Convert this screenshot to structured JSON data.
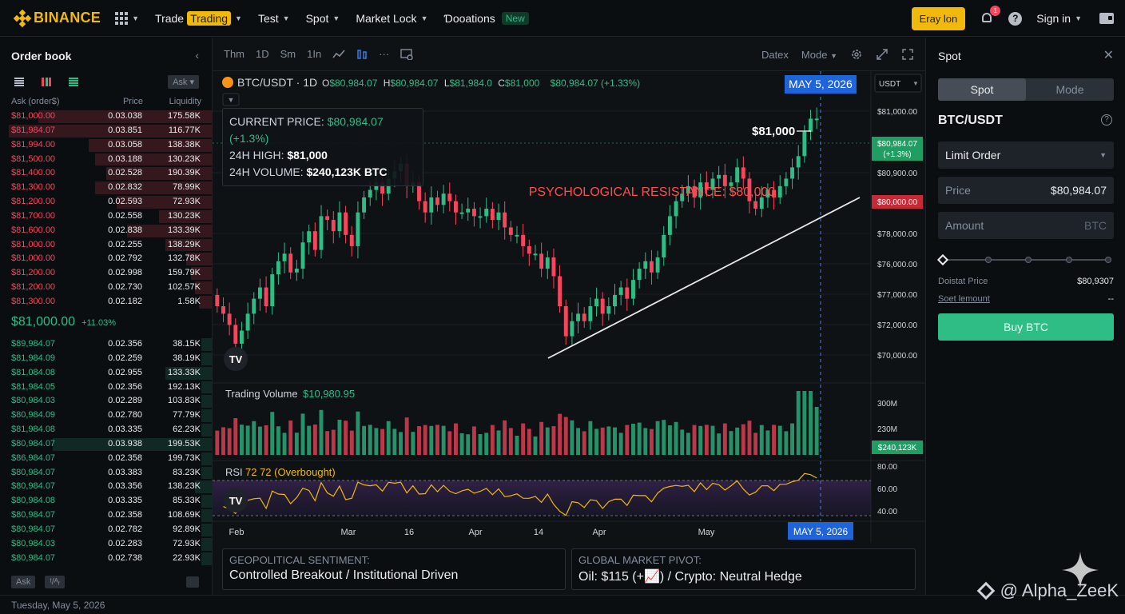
{
  "brand": {
    "name": "BINANCE"
  },
  "nav": {
    "items": [
      {
        "label": "Trade",
        "pill": "Trading"
      },
      {
        "label": "Test"
      },
      {
        "label": "Spot"
      },
      {
        "label": "Market Lock"
      },
      {
        "label": "Ɗooations",
        "badge": "New"
      }
    ],
    "cta": "Eray lon",
    "notif_count": "1",
    "help_glyph": "?",
    "signin": "Sign in"
  },
  "orderbook": {
    "title": "Order book",
    "ask_select": "Ask",
    "headers": {
      "c1": "Ask (order$)",
      "c2": "Price",
      "c3": "Liquidity"
    },
    "asks": [
      {
        "p": "$81,000.00",
        "q": "0.03.038",
        "l": "175.58K",
        "d": 0.82
      },
      {
        "p": "$81,984.07",
        "q": "0.03.851",
        "l": "116.77K",
        "d": 0.96
      },
      {
        "p": "$81,994.00",
        "q": "0.03.058",
        "l": "138.38K",
        "d": 0.58
      },
      {
        "p": "$81,500.00",
        "q": "0.03.188",
        "l": "130.23K",
        "d": 0.55
      },
      {
        "p": "$81,400.00",
        "q": "0.02.528",
        "l": "190.39K",
        "d": 0.5
      },
      {
        "p": "$81,300.00",
        "q": "0.02.832",
        "l": "78.99K",
        "d": 0.55
      },
      {
        "p": "$81,200.00",
        "q": "0.02.593",
        "l": "72.93K",
        "d": 0.45
      },
      {
        "p": "$81,700.00",
        "q": "0.02.558",
        "l": "130.23K",
        "d": 0.25
      },
      {
        "p": "$81,600.00",
        "q": "0.02.838",
        "l": "133.39K",
        "d": 0.4
      },
      {
        "p": "$81,000.00",
        "q": "0.02.255",
        "l": "138.29K",
        "d": 0.22
      },
      {
        "p": "$81,000.00",
        "q": "0.02.792",
        "l": "132.78K",
        "d": 0.12
      },
      {
        "p": "$81,200.00",
        "q": "0.02.998",
        "l": "159.79K",
        "d": 0.1
      },
      {
        "p": "$81,200.00",
        "q": "0.02.730",
        "l": "102.57K",
        "d": 0.08
      },
      {
        "p": "$81,300.00",
        "q": "0.02.182",
        "l": "1.58K",
        "d": 0.06
      }
    ],
    "mid_price": "$81,000.00",
    "mid_change": "+11.03%",
    "bids": [
      {
        "p": "$89,984.07",
        "q": "0.02.356",
        "l": "38.15K",
        "d": 0.05
      },
      {
        "p": "$81,984.09",
        "q": "0.02.259",
        "l": "38.19K",
        "d": 0.05
      },
      {
        "p": "$81,084.08",
        "q": "0.02.955",
        "l": "133.33K",
        "d": 0.22
      },
      {
        "p": "$81,984.05",
        "q": "0.02.356",
        "l": "192.13K",
        "d": 0.05
      },
      {
        "p": "$80,984.03",
        "q": "0.02.289",
        "l": "103.83K",
        "d": 0.05
      },
      {
        "p": "$80,984.09",
        "q": "0.02.780",
        "l": "77.79K",
        "d": 0.05
      },
      {
        "p": "$81,984.08",
        "q": "0.03.335",
        "l": "62.23K",
        "d": 0.05
      },
      {
        "p": "$80,984.07",
        "q": "0.03.938",
        "l": "199.53K",
        "d": 0.75
      },
      {
        "p": "$86,984.07",
        "q": "0.02.358",
        "l": "199.73K",
        "d": 0.05
      },
      {
        "p": "$80,984.07",
        "q": "0.03.383",
        "l": "83.23K",
        "d": 0.05
      },
      {
        "p": "$80,984.07",
        "q": "0.03.356",
        "l": "138.23K",
        "d": 0.08
      },
      {
        "p": "$80,984.08",
        "q": "0.03.335",
        "l": "85.33K",
        "d": 0.05
      },
      {
        "p": "$80,984.07",
        "q": "0.02.358",
        "l": "108.69K",
        "d": 0.05
      },
      {
        "p": "$80,984.07",
        "q": "0.02.782",
        "l": "92.89K",
        "d": 0.05
      },
      {
        "p": "$80,984.03",
        "q": "0.02.283",
        "l": "72.93K",
        "d": 0.05
      },
      {
        "p": "$80,984.07",
        "q": "0.02.738",
        "l": "22.93K",
        "d": 0.05
      }
    ],
    "footer_left": "Ask",
    "footer_chip": "ᵗ/ᴬᵣ"
  },
  "chart_toolbar": {
    "intervals": [
      "Thm",
      "1D",
      "Sm",
      "1In"
    ],
    "right": [
      "Datex",
      "Mode"
    ]
  },
  "chart_data": {
    "type": "candlestick",
    "symbol": "BTC/USDT · 1D",
    "ohlc_text": {
      "o": "$80,984.07",
      "h": "$80,984.07",
      "l": "$81,984.0",
      "c": "$81,000",
      "chg": "$80,984.07 (+1.33%)"
    },
    "date_flag": "MAY 5, 2026",
    "currency_select": "USDT",
    "price_axis_labels": [
      "$81,000.00",
      "$80,900.00",
      "$78,000.00",
      "$76,000.00",
      "$77,000.00",
      "$72,000.00",
      "$70,000.00"
    ],
    "current_price_tag": [
      "$80,984.07",
      "(+1.3%)"
    ],
    "resistance": {
      "label": "PSYCHOLOGICAL RESISTANCE: $80,000",
      "tag": "$80,000.00"
    },
    "peak_label": "$81,000",
    "x_labels": [
      "Feb",
      "Mar",
      "16",
      "Apr",
      "14",
      "Apr",
      "May",
      "MAY 5, 2026"
    ],
    "candle_closes": [
      72.6,
      72.2,
      71.6,
      70.6,
      71.3,
      72.2,
      73.0,
      73.6,
      72.6,
      74.3,
      75.0,
      75.4,
      74.4,
      74.6,
      76.0,
      76.6,
      75.6,
      77.4,
      77.2,
      76.6,
      77.6,
      76.4,
      75.8,
      77.6,
      78.4,
      78.8,
      79.2,
      78.6,
      79.4,
      79.8,
      80.2,
      79.0,
      79.2,
      78.2,
      77.6,
      78.4,
      78.0,
      78.6,
      78.2,
      77.6,
      77.6,
      77.8,
      77.4,
      77.4,
      77.8,
      77.2,
      77.6,
      76.8,
      76.4,
      76.4,
      75.8,
      75.4,
      75.4,
      74.6,
      75.2,
      74.2,
      72.6,
      71.0,
      71.8,
      72.2,
      71.8,
      72.6,
      73.0,
      72.2,
      72.6,
      73.2,
      73.6,
      73.0,
      74.0,
      74.6,
      75.0,
      74.4,
      75.2,
      76.4,
      77.4,
      78.2,
      78.6,
      79.0,
      78.4,
      79.2,
      78.8,
      79.4,
      79.6,
      79.0,
      79.2,
      80.0,
      79.4,
      78.2,
      77.8,
      78.4,
      78.8,
      78.4,
      79.0,
      79.4,
      80.0,
      80.6,
      81.9,
      82.6,
      82.6
    ],
    "volume_panel": {
      "label": "Trading Volume",
      "value": "$10,980.95",
      "axis": [
        "300M",
        "230M"
      ],
      "tag": "$240,123K"
    },
    "rsi_panel": {
      "label": "RSI",
      "value": "72 72 (Overbought)",
      "axis": [
        "80.00",
        "60.00",
        "40.00"
      ]
    }
  },
  "info_box": {
    "l1": "CURRENT PRICE:",
    "v1": "$80,984.07 (+1.3%)",
    "l2": "24H HIGH:",
    "v2": "$81,000",
    "l3": "24H VOLUME:",
    "v3": "$240,123K BTC"
  },
  "cards": [
    {
      "label": "GEOPOLITICAL SENTIMENT:",
      "value": "Controlled Breakout / Institutional Driven"
    },
    {
      "label": "GLOBAL MARKET PIVOT:",
      "value": "Oil: $115 (+📈) / Crypto: Neutral Hedge"
    }
  ],
  "spot": {
    "title": "Spot",
    "tabs": [
      "Spot",
      "Mode"
    ],
    "pair": "BTC/USDT",
    "order_type": "Limit Order",
    "price_label": "Price",
    "price_value": "$80,984.07",
    "amount_label": "Amount",
    "amount_unit": "BTC",
    "kv1_label": "Doistat Price",
    "kv1_value": "$80,9307",
    "kv2_label": "Soet lemount",
    "kv2_value": "--",
    "buy": "Buy BTC"
  },
  "status": {
    "date": "Tuesday, May 5, 2026"
  },
  "watermark": "@ Alpha_ZeeK",
  "colors": {
    "up": "#2ebd85",
    "down": "#f6465d",
    "accent": "#f0b90b",
    "resistance": "#ff3b3b"
  }
}
